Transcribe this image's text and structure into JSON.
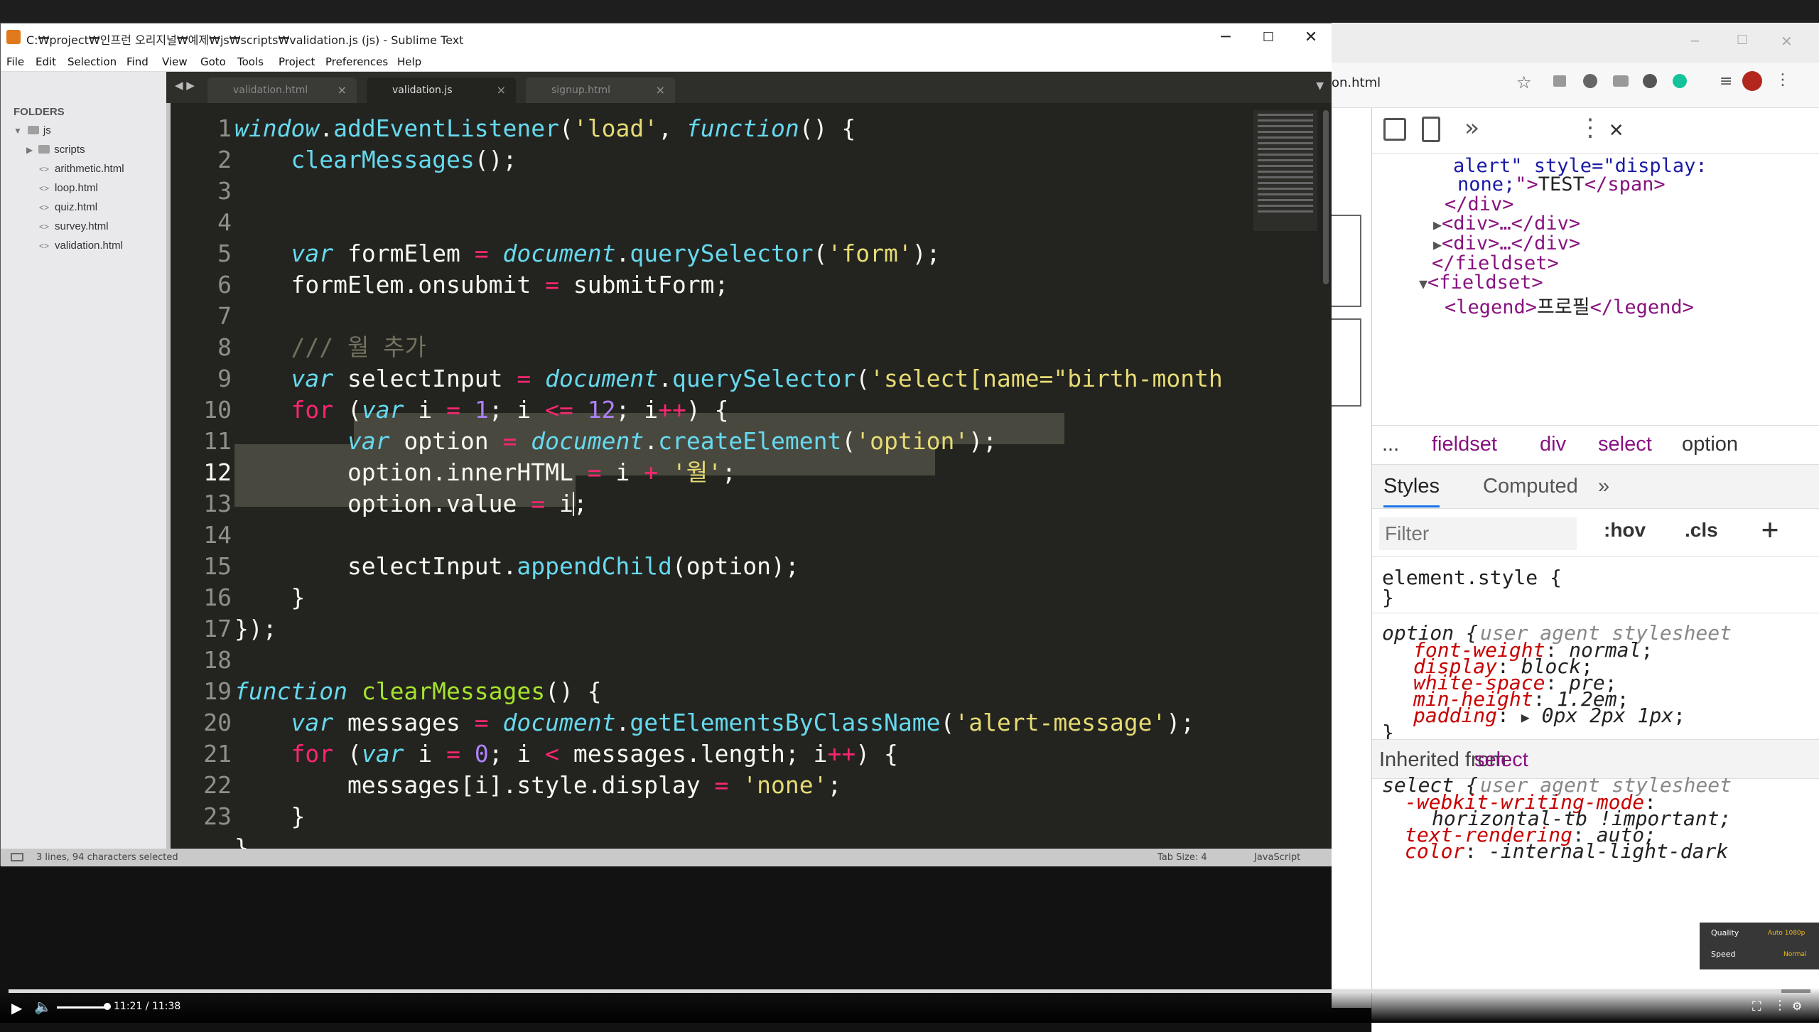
{
  "window": {
    "title": "C:₩project₩인프런 오리지널₩예제₩js₩scripts₩validation.js (js) - Sublime Text",
    "min": "─",
    "max": "☐",
    "close": "✕"
  },
  "menu": [
    "File",
    "Edit",
    "Selection",
    "Find",
    "View",
    "Goto",
    "Tools",
    "Project",
    "Preferences",
    "Help"
  ],
  "sidebar": {
    "header": "FOLDERS",
    "root": "js",
    "folder": "scripts",
    "files": [
      "arithmetic.html",
      "loop.html",
      "quiz.html",
      "survey.html",
      "validation.html"
    ]
  },
  "tabs": [
    {
      "label": "validation.html"
    },
    {
      "label": "validation.js"
    },
    {
      "label": "signup.html"
    }
  ],
  "tab_close": "×",
  "editor": {
    "line_numbers": [
      "1",
      "2",
      "3",
      "4",
      "5",
      "6",
      "7",
      "8",
      "9",
      "10",
      "11",
      "12",
      "13",
      "14",
      "15",
      "16",
      "17",
      "18",
      "19",
      "20",
      "21",
      "22",
      "23"
    ]
  },
  "status": {
    "left": "3 lines, 94 characters selected",
    "tab": "Tab Size: 4",
    "syntax": "JavaScript"
  },
  "chrome": {
    "address": "on.html"
  },
  "devtools": {
    "dom": {
      "l1": "alert\" style=\"display:",
      "l2a": "none;",
      "l2b": "\">",
      "l2c": "TEST",
      "l2d": "</span>",
      "l3": "</div>",
      "l4": "<div>…</div>",
      "l5": "<div>…</div>",
      "l6": "</fieldset>",
      "l7": "<fieldset>",
      "l8a": "<legend>",
      "l8b": "프로필",
      "l8c": "</legend>"
    },
    "breadcrumb": [
      "...",
      "fieldset",
      "div",
      "select",
      "option"
    ],
    "style_tabs": [
      "Styles",
      "Computed",
      "»"
    ],
    "filter_placeholder": "Filter",
    "hov": ":hov",
    "cls": ".cls",
    "plus": "+",
    "element_style": "element.style {",
    "close_brace": "}",
    "option_rule": {
      "selector": "option",
      "open": "{",
      "origin": "user agent stylesheet",
      "props": [
        [
          "font-weight",
          "normal"
        ],
        [
          "display",
          "block"
        ],
        [
          "white-space",
          "pre"
        ],
        [
          "min-height",
          "1.2em"
        ],
        [
          "padding",
          "0px 2px 1px"
        ]
      ]
    },
    "inherited_label": "Inherited from",
    "inherited_from": "select",
    "select_rule": {
      "selector": "select",
      "open": "{",
      "origin": "user agent stylesheet",
      "p1": "-webkit-writing-mode",
      "v1": "horizontal-tb !important;",
      "p2": "text-rendering",
      "v2": "auto;",
      "p3": "color",
      "v3": "-internal-light-dark"
    }
  },
  "video": {
    "time": "11:21 / 11:38",
    "quality": "Quality",
    "speed": "Speed",
    "q_val": "Auto 1080p",
    "s_val": "Normal",
    "progress": 0.984
  },
  "colors": {
    "accent": "#f92672",
    "selection": "#49483e"
  }
}
